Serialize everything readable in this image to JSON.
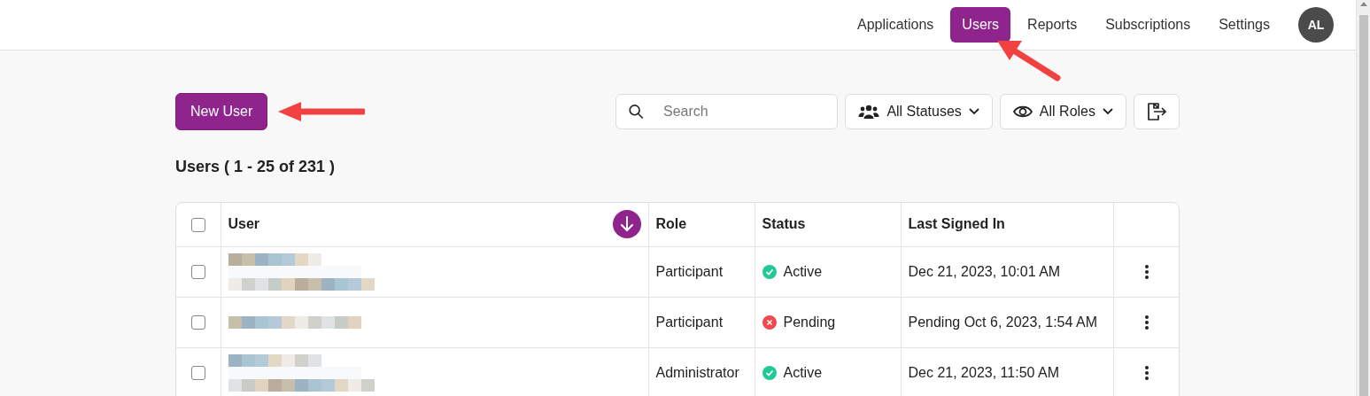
{
  "nav": {
    "items": [
      {
        "label": "Applications",
        "selected": false
      },
      {
        "label": "Users",
        "selected": true
      },
      {
        "label": "Reports",
        "selected": false
      },
      {
        "label": "Subscriptions",
        "selected": false
      },
      {
        "label": "Settings",
        "selected": false
      }
    ],
    "avatar": "AL"
  },
  "toolbar": {
    "new_button": "New User",
    "search": {
      "placeholder": "Search"
    },
    "status_filter": "All Statuses",
    "role_filter": "All Roles"
  },
  "summary": "Users ( 1 - 25 of 231 )",
  "table": {
    "columns": [
      "User",
      "Role",
      "Status",
      "Last Signed In"
    ],
    "select_all_checked": false,
    "rows": [
      {
        "checked": false,
        "kind": "two_line",
        "role": "Participant",
        "status": {
          "text": "Active",
          "kind": "ok",
          "color": "#20c997"
        },
        "last_signed_in": "Dec 21, 2023, 10:01 AM"
      },
      {
        "checked": false,
        "kind": "one_line",
        "role": "Participant",
        "status": {
          "text": "Pending",
          "kind": "error",
          "color": "#f0484e"
        },
        "last_signed_in": "Pending Oct 6, 2023, 1:54 AM"
      },
      {
        "checked": false,
        "kind": "two_line",
        "role": "Administrator",
        "status": {
          "text": "Active",
          "kind": "ok",
          "color": "#20c997"
        },
        "last_signed_in": "Dec 21, 2023, 11:50 AM"
      }
    ]
  }
}
